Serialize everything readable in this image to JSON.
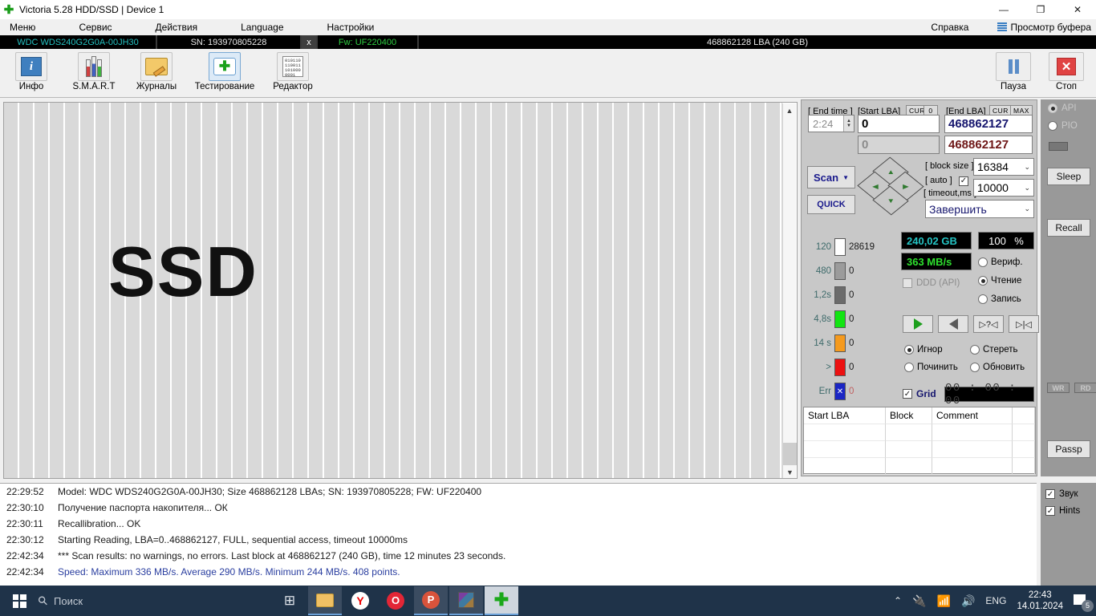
{
  "window": {
    "title": "Victoria 5.28 HDD/SSD | Device 1",
    "minimize": "—",
    "restore": "❐",
    "close": "✕"
  },
  "menu": {
    "items": [
      "Меню",
      "Сервис",
      "Действия",
      "Language",
      "Настройки"
    ],
    "help": "Справка",
    "buffer_view": "Просмотр буфера"
  },
  "device_bar": {
    "model": "WDC WDS240G2G0A-00JH30",
    "sn": "SN: 193970805228",
    "x": "x",
    "fw": "Fw: UF220400",
    "capacity": "468862128 LBA (240 GB)"
  },
  "toolbar": {
    "buttons": [
      {
        "label": "Инфо",
        "icon": "info-icon"
      },
      {
        "label": "S.M.A.R.T",
        "icon": "smart-icon"
      },
      {
        "label": "Журналы",
        "icon": "folder-icon"
      },
      {
        "label": "Тестирование",
        "icon": "test-icon"
      },
      {
        "label": "Редактор",
        "icon": "editor-icon"
      }
    ],
    "pause": "Пауза",
    "stop": "Стоп"
  },
  "map": {
    "label": "SSD"
  },
  "controls": {
    "end_time_label": "[ End time ]",
    "end_time_value": "2:24",
    "start_lba_label": "[Start LBA]",
    "start_lba_cur": "CUR",
    "start_lba_zero": "0",
    "start_lba_value": "0",
    "start_lba_value2": "0",
    "end_lba_label": "[End LBA]",
    "end_lba_cur": "CUR",
    "end_lba_max": "MAX",
    "end_lba_value": "468862127",
    "end_lba_value2": "468862127",
    "scan_button": "Scan",
    "quick_button": "QUICK",
    "block_size_label": "[ block size ]",
    "block_size_value": "16384",
    "auto_label": "[ auto ]",
    "timeout_label": "[ timeout,ms ]",
    "timeout_value": "10000",
    "finish_value": "Завершить"
  },
  "legend": {
    "rows": [
      {
        "time": "120",
        "count": "28619",
        "color": "#ffffff"
      },
      {
        "time": "480",
        "count": "0",
        "color": "#9b9b9b"
      },
      {
        "time": "1,2s",
        "count": "0",
        "color": "#6b6b6b"
      },
      {
        "time": "4,8s",
        "count": "0",
        "color": "#12e512"
      },
      {
        "time": "14 s",
        "count": "0",
        "color": "#f59a1e"
      },
      {
        "time": ">",
        "count": "0",
        "color": "#ec1111"
      },
      {
        "time": "Err",
        "count": "0",
        "color": "#1b26c4"
      }
    ]
  },
  "stats": {
    "capacity": "240,02 GB",
    "speed": "363 MB/s",
    "percent": "100",
    "percent_sign": "%",
    "ddd_label": "DDD (API)",
    "modes": [
      {
        "label": "Вериф.",
        "selected": false
      },
      {
        "label": "Чтение",
        "selected": true
      },
      {
        "label": "Запись",
        "selected": false
      }
    ]
  },
  "actions": {
    "media": [
      "play-icon",
      "rewind-icon",
      "step-question-icon",
      "skip-end-icon"
    ],
    "radios": [
      {
        "label": "Игнор",
        "selected": true
      },
      {
        "label": "Стереть",
        "selected": false
      },
      {
        "label": "Починить",
        "selected": false
      },
      {
        "label": "Обновить",
        "selected": false
      }
    ],
    "grid_label": "Grid",
    "grid_checked": true,
    "timer": "00 : 00 : 00"
  },
  "defect_table": {
    "headers": [
      "Start LBA",
      "Block",
      "Comment"
    ],
    "rows": []
  },
  "rail": {
    "api": "API",
    "pio": "PIO",
    "sleep": "Sleep",
    "recall": "Recall",
    "wr": "WR",
    "rd": "RD",
    "passp": "Passp"
  },
  "log": {
    "lines": [
      {
        "time": "22:29:52",
        "text": "Model: WDC WDS240G2G0A-00JH30; Size 468862128 LBAs; SN: 193970805228; FW: UF220400",
        "blue": false
      },
      {
        "time": "22:30:10",
        "text": "Получение паспорта накопителя... ОК",
        "blue": false
      },
      {
        "time": "22:30:11",
        "text": "Recallibration... OK",
        "blue": false
      },
      {
        "time": "22:30:12",
        "text": "Starting Reading, LBA=0..468862127, FULL, sequential access, timeout 10000ms",
        "blue": false
      },
      {
        "time": "22:42:34",
        "text": "*** Scan results: no warnings, no errors. Last block at 468862127 (240 GB), time 12 minutes 23 seconds.",
        "blue": false
      },
      {
        "time": "22:42:34",
        "text": "Speed: Maximum 336 MB/s. Average 290 MB/s. Minimum 244 MB/s. 408 points.",
        "blue": true
      }
    ]
  },
  "options": {
    "sound": "Звук",
    "hints": "Hints"
  },
  "taskbar": {
    "search_placeholder": "Поиск",
    "language": "ENG",
    "time": "22:43",
    "date": "14.01.2024",
    "notification_count": "5"
  }
}
